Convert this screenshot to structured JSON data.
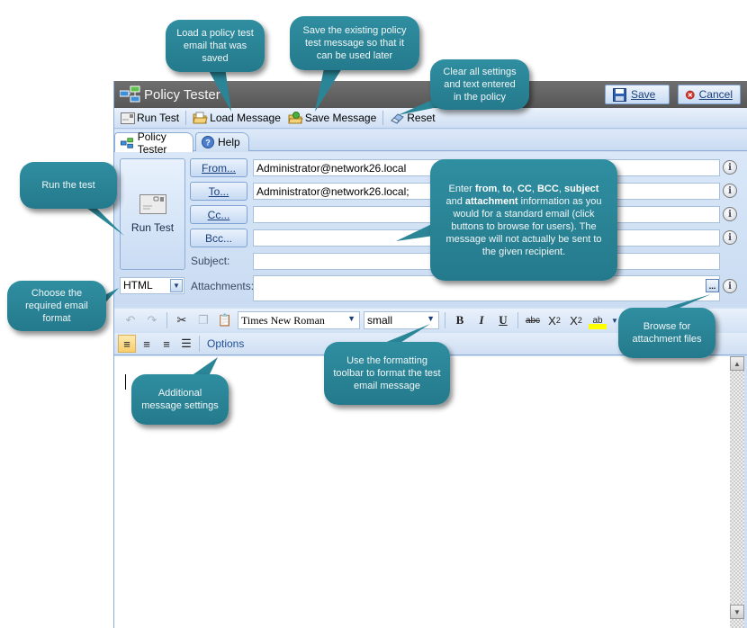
{
  "window": {
    "title": "Policy Tester",
    "save_label": "Save",
    "cancel_label": "Cancel"
  },
  "toolbar": {
    "run_test": "Run Test",
    "load_message": "Load Message",
    "save_message": "Save Message",
    "reset": "Reset"
  },
  "tabs": [
    {
      "label": "Policy Tester",
      "active": true
    },
    {
      "label": "Help",
      "active": false
    }
  ],
  "form": {
    "run_test_label": "Run Test",
    "from_button": "From...",
    "to_button": "To...",
    "cc_button": "Cc...",
    "bcc_button": "Bcc...",
    "from_value": "Administrator@network26.local",
    "to_value": "Administrator@network26.local;",
    "cc_value": "",
    "bcc_value": "",
    "subject_label": "Subject:",
    "subject_value": "",
    "attachments_label": "Attachments:",
    "attachments_value": "",
    "format_value": "HTML",
    "browse_label": "..."
  },
  "formatting": {
    "font": "Times New Roman",
    "size": "small",
    "options_label": "Options"
  },
  "callouts": {
    "load": "Load a policy test email that was saved",
    "save": "Save the existing policy test message so that it can be used later",
    "reset": "Clear all settings and text entered in the policy",
    "run": "Run the test",
    "format": "Choose the required email format",
    "fields_pre": "Enter ",
    "fields_b1": "from",
    "fields_s1": ", ",
    "fields_b2": "to",
    "fields_s2": ", ",
    "fields_b3": "CC",
    "fields_s3": ", ",
    "fields_b4": "BCC",
    "fields_s4": ", ",
    "fields_b5": "subject",
    "fields_s5": " and ",
    "fields_b6": "attachment",
    "fields_post": " information as you would for a standard email (click buttons to browse for users). The message will not actually be sent to the given recipient.",
    "browse": "Browse for attachment files",
    "toolbar": "Use the formatting toolbar to format the test email message",
    "options": "Additional message settings"
  },
  "colors": {
    "callout_bg": "#2a8597",
    "titlebar": "#626262",
    "panel": "#cfe0f5"
  }
}
